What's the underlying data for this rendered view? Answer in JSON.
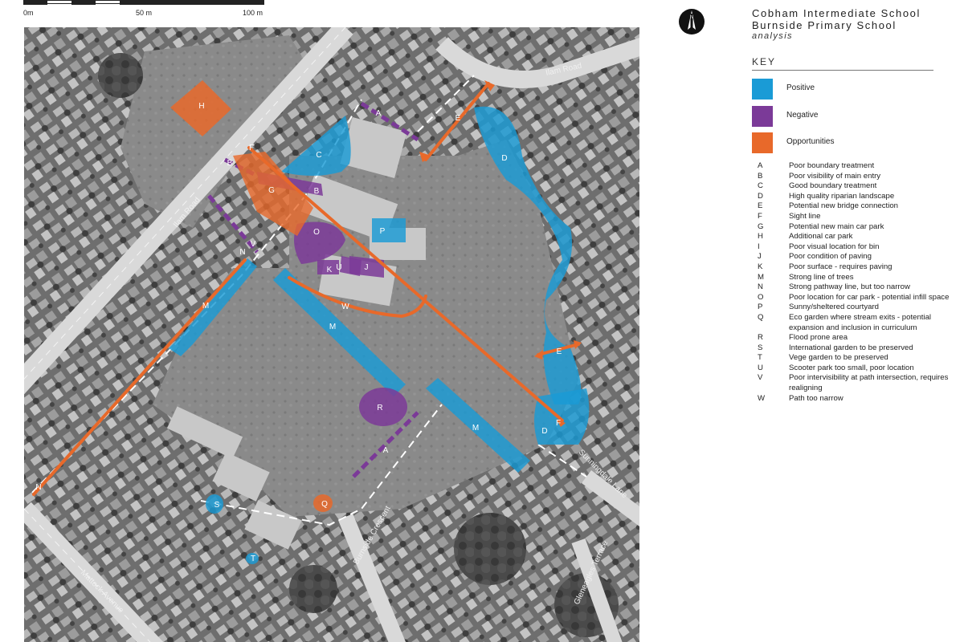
{
  "scale_bar": {
    "labels": [
      "0m",
      "50 m",
      "100 m"
    ]
  },
  "title": {
    "line1": "Cobham Intermediate School",
    "line2": "Burnside Primary School",
    "line3": "analysis"
  },
  "north_arrow": {
    "letter": "N",
    "icon": "north-arrow-icon"
  },
  "key": {
    "heading": "KEY",
    "categories": [
      {
        "label": "Positive",
        "color": "#1a9bd6"
      },
      {
        "label": "Negative",
        "color": "#7b3a98"
      },
      {
        "label": "Opportunities",
        "color": "#e8692a"
      }
    ],
    "codes": [
      {
        "code": "A",
        "desc": "Poor boundary treatment"
      },
      {
        "code": "B",
        "desc": "Poor visibility of main entry"
      },
      {
        "code": "C",
        "desc": "Good boundary treatment"
      },
      {
        "code": "D",
        "desc": "High quality riparian landscape"
      },
      {
        "code": "E",
        "desc": "Potential new bridge connection"
      },
      {
        "code": "F",
        "desc": "Sight line"
      },
      {
        "code": "G",
        "desc": "Potential new main car park"
      },
      {
        "code": "H",
        "desc": "Additional car park"
      },
      {
        "code": "I",
        "desc": "Poor visual location for bin"
      },
      {
        "code": "J",
        "desc": "Poor condition of paving"
      },
      {
        "code": "K",
        "desc": "Poor surface - requires paving"
      },
      {
        "code": "M",
        "desc": "Strong line of trees"
      },
      {
        "code": "N",
        "desc": "Strong pathway line, but too narrow"
      },
      {
        "code": "O",
        "desc": "Poor location for car park - potential infill space"
      },
      {
        "code": "P",
        "desc": "Sunny/sheltered courtyard"
      },
      {
        "code": "Q",
        "desc": "Eco garden where stream exits - potential expansion and inclusion in curriculum"
      },
      {
        "code": "R",
        "desc": "Flood prone area"
      },
      {
        "code": "S",
        "desc": "International garden to be preserved"
      },
      {
        "code": "T",
        "desc": "Vege garden to be preserved"
      },
      {
        "code": "U",
        "desc": "Scooter park too small, poor location"
      },
      {
        "code": "V",
        "desc": "Poor intervisibility at path intersection, requires realigning"
      },
      {
        "code": "W",
        "desc": "Path too narrow"
      }
    ]
  },
  "map": {
    "street_labels": [
      "Ilam Road",
      "Ilam Road",
      "Mattock Avenue",
      "Burnside Crescent",
      "Sunningdale Lane",
      "Gleneagles Terrace"
    ],
    "zone_labels": {
      "positive": [
        "C",
        "D",
        "D",
        "P",
        "M",
        "M",
        "M",
        "S",
        "T"
      ],
      "negative": [
        "A",
        "A",
        "B",
        "B",
        "O",
        "U",
        "K",
        "J",
        "V",
        "R"
      ],
      "opportunity": [
        "H",
        "G",
        "F",
        "F",
        "E",
        "E",
        "W",
        "N",
        "N",
        "Q"
      ]
    }
  }
}
